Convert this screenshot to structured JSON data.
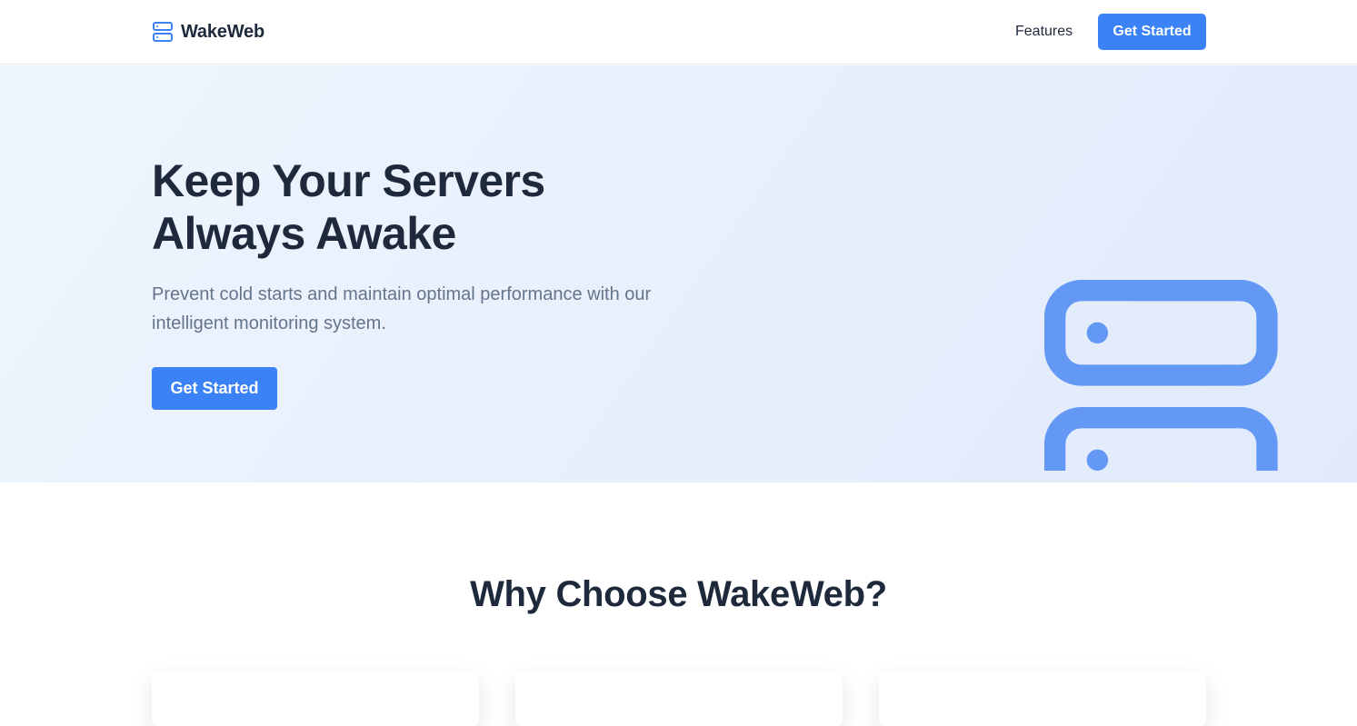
{
  "app": {
    "brand_name": "WakeWeb",
    "brand_icon": "server-icon",
    "accent_color": "#3b82f6"
  },
  "nav": {
    "items": [
      {
        "label": "Features"
      }
    ],
    "cta_label": "Get Started"
  },
  "hero": {
    "title_line_1": "Keep Your Servers",
    "title_line_2": "Always Awake",
    "subtitle": "Prevent cold starts and maintain optimal performance with our intelligent monitoring system.",
    "cta_label": "Get Started",
    "illustration_icon": "server-icon",
    "illustration_color": "#6398f5"
  },
  "features": {
    "title": "Why Choose WakeWeb?",
    "cards": [
      {
        "icon": "feature-card"
      },
      {
        "icon": "feature-card"
      },
      {
        "icon": "feature-card"
      }
    ]
  }
}
